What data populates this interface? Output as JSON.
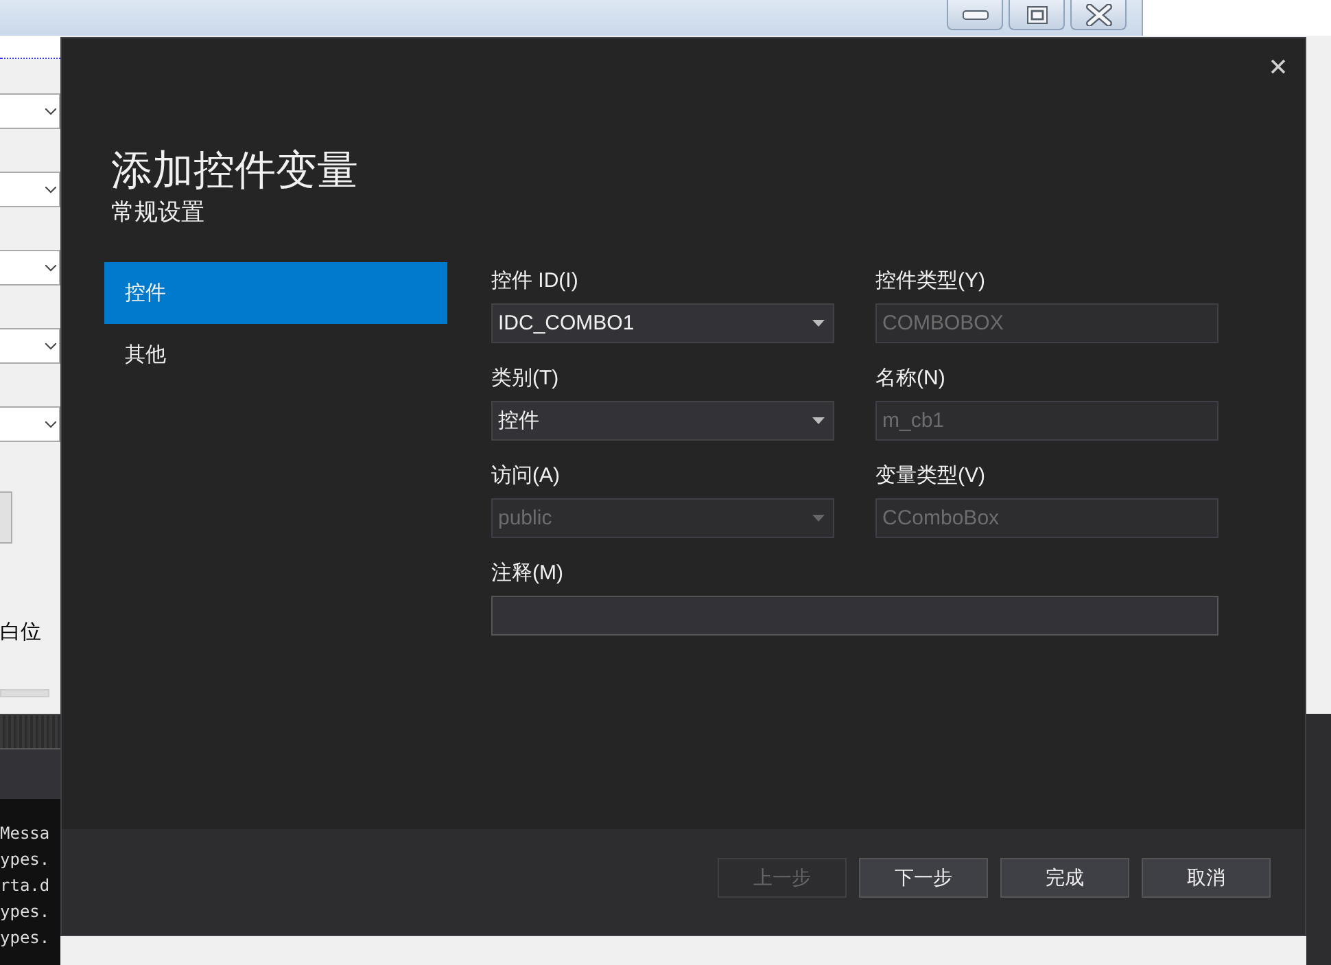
{
  "background_window": {
    "form_label": "白位",
    "output_lines": [
      "Messa",
      "ypes.",
      "rta.d",
      "ypes.",
      "ypes."
    ]
  },
  "dialog": {
    "title": "添加控件变量",
    "subtitle": "常规设置",
    "nav_items": [
      {
        "label": "控件",
        "selected": true
      },
      {
        "label": "其他",
        "selected": false
      }
    ],
    "fields": [
      {
        "kind": "combo",
        "label": "控件 ID(I)",
        "value": "IDC_COMBO1",
        "disabled": false
      },
      {
        "kind": "text",
        "label": "控件类型(Y)",
        "value": "COMBOBOX",
        "disabled": true
      },
      {
        "kind": "combo",
        "label": "类别(T)",
        "value": "控件",
        "disabled": false
      },
      {
        "kind": "text",
        "label": "名称(N)",
        "value": "m_cb1",
        "disabled": true
      },
      {
        "kind": "combo",
        "label": "访问(A)",
        "value": "public",
        "disabled": true
      },
      {
        "kind": "text",
        "label": "变量类型(V)",
        "value": "CComboBox",
        "disabled": true
      },
      {
        "kind": "wide",
        "label": "注释(M)",
        "disabled": false
      }
    ],
    "buttons": [
      {
        "label": "上一步",
        "disabled": true
      },
      {
        "label": "下一步",
        "disabled": false
      },
      {
        "label": "完成",
        "disabled": false
      },
      {
        "label": "取消",
        "disabled": false
      }
    ]
  }
}
